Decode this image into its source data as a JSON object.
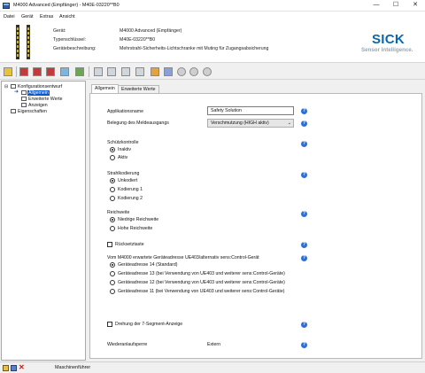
{
  "window": {
    "title": "M4000 Advanced (Empfänger) - M40E-03220**B0",
    "minimize": "—",
    "maximize": "☐",
    "close": "✕"
  },
  "menu": [
    "Datei",
    "Gerät",
    "Extras",
    "Ansicht"
  ],
  "device_info": {
    "labels": [
      "Gerät:",
      "Typenschlüssel:",
      "Gerätebeschreibung:"
    ],
    "values": [
      "M4000 Advanced (Empfänger)",
      "M40E-03220**B0",
      "Mehrstrahl-Sicherheits-Lichtschranke mit Muting für Zugangsabsicherung"
    ]
  },
  "logo": {
    "brand": "SICK",
    "tagline": "Sensor Intelligence."
  },
  "tree": {
    "root": "Konfigurationsentwurf",
    "items": [
      "Allgemein",
      "Erweiterte Werte",
      "Anzeigen"
    ],
    "properties": "Eigenschaften"
  },
  "tabs": [
    "Allgemein",
    "Erweiterte Werte"
  ],
  "form": {
    "app_name_label": "Applikationsname",
    "app_name_value": "Safety Solution",
    "output_label": "Belegung des Meldeausgangs",
    "output_value": "Verschmutzung (HIGH aktiv)",
    "contactor": {
      "label": "Schützkontrolle",
      "options": [
        "Inaktiv",
        "Aktiv"
      ],
      "selected": 0
    },
    "beam_coding": {
      "label": "Strahlkodierung",
      "options": [
        "Unkodiert",
        "Kodierung 1",
        "Kodierung 2"
      ],
      "selected": 0
    },
    "range": {
      "label": "Reichweite",
      "options": [
        "Niedrige Reichweite",
        "Hohe Reichweite"
      ],
      "selected": 0
    },
    "reset_button_label": "Rücksetztaste",
    "address": {
      "label": "Vom M4000 erwartete Geräteadresse UE403/alternativ sens:Control-Gerät",
      "options": [
        "Geräteadresse 14 (Standard)",
        "Geräteadresse 13 (bei Verwendung von UE403 und weiterer sens:Control-Geräte)",
        "Geräteadresse 12 (bei Verwendung von UE403 und weiterer sens:Control-Geräte)",
        "Geräteadresse 11 (bei Verwendung von UE403 und weiterer sens:Control-Geräte)"
      ],
      "selected": 0
    },
    "rotate_display_label": "Drehung der 7-Segment-Anzeige",
    "restart_label": "Wiederanlaufsperre",
    "restart_value": "Extern",
    "help_glyph": "?"
  },
  "status": {
    "user": "Maschinenführer"
  },
  "colors": {
    "accent": "#0a58c8",
    "brand": "#0a66b0",
    "help": "#2f6fd1"
  }
}
